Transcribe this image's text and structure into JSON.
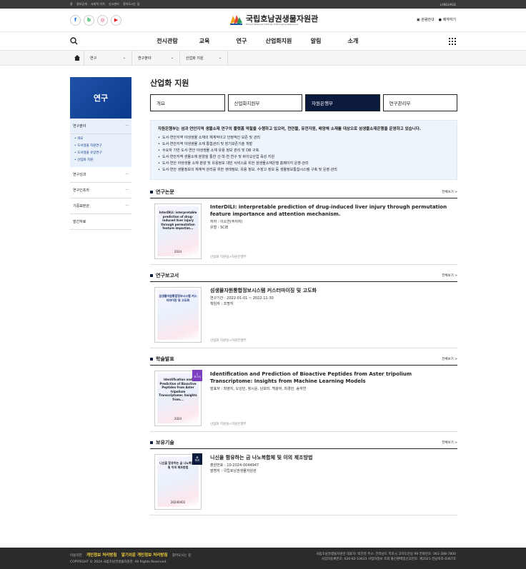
{
  "topbar": {
    "links": [
      "홈",
      "정보공개",
      "사회적 가치",
      "신고센터",
      "찾아오시는 길"
    ],
    "language": "LANGUAGE"
  },
  "header": {
    "sns": [
      "f",
      "b",
      "◎",
      "▶"
    ],
    "logo_name": "국립호남권생물자원관",
    "logo_sub": "Honam National Institute of Biological Resources",
    "right_links": [
      "관람안내",
      "예약하기"
    ]
  },
  "gnb": {
    "menu": [
      "전시관람",
      "교육",
      "연구",
      "산업화지원",
      "알림",
      "소개"
    ]
  },
  "breadcrumb": [
    "연구",
    "연구분야",
    "산업화 지원"
  ],
  "sidebar": {
    "title": "연구",
    "items": [
      {
        "label": "연구분야",
        "subs": [
          "개요",
          "도서생물 자원연구",
          "도서생물 유망연구",
          "산업화 지원"
        ]
      },
      {
        "label": "연구성과"
      },
      {
        "label": "연구인프라"
      },
      {
        "label": "기증표본관"
      },
      {
        "label": "발간자료"
      }
    ]
  },
  "main": {
    "title": "산업화 지원",
    "tabs": [
      "개요",
      "산업화지원부",
      "자원은행부",
      "연구관리부"
    ],
    "active_tab": 2,
    "intro_lead": "자원은행부는 섬과 연안지역 생물소재 연구의 플랫폼 역할을 수행하고 있으며, 천연물, 유전자원, 배양체 소재를 대상으로 섬생물소재은행을 운영하고 있습니다.",
    "intro_items": [
      "도서·연안지역 야생생물 소재의 체계적이고 안정적인 보존 및 관리",
      "도서·연안지역 야생생물 소재 통합관리 및 장기보존기술 개발",
      "수요자 기반 도서·연안 야생생물 소재 유용 정보 관리 및 DB 구축",
      "도서·연안지역 생물소재 분양을 통한 산·학·연 연구 및 바이오산업 육성 지원",
      "도서·연안 야생생물 소재 분양 및 유용정보 대민 서비스를 위한 섬생물소재은행 홈페이지 운영·관리",
      "도서·연안 생물정보의 체계적 관리를 위한 생태정보, 유용 정보, 수장고 정보 등 생물정보통합시스템 구축 및 운영·관리"
    ]
  },
  "sections": [
    {
      "title": "연구논문",
      "more": "전체보기 >",
      "thumb_text": "InterDILI: interpretable prediction of drug-induced liver injury through permutation feature importan...",
      "thumb_year": "2024",
      "badge": "",
      "heading": "InterDILI: interpretable prediction of drug-induced liver injury through permutation feature importance and attention mechanism.",
      "meta": [
        "저자 : 이소연(주저자)",
        "유형 : SCIE"
      ],
      "path": "산업화 지원실>자원은행부"
    },
    {
      "title": "연구보고서",
      "more": "전체보기 >",
      "thumb_text": "섬생물자원통합정보시스템 커스터마이징 및 고도화",
      "thumb_year": "",
      "badge": "",
      "heading": "섬생물자원통합정보시스템 커스터마이징 및 고도화",
      "meta": [
        "연구기간 : 2022-01-01 ~ 2022-11-30",
        "책임자 : 조명지"
      ],
      "path": "산업화 지원실>자원은행부"
    },
    {
      "title": "학술발표",
      "more": "전체보기 >",
      "thumb_text": "Identification and Prediction of Bioactive Peptides from Aster tripolium Transcriptome: Insights from...",
      "thumb_year": "2024",
      "badge": "포스터",
      "heading": "Identification and Prediction of Bioactive Peptides from Aster tripolium Transcriptome: Insights from Machine Learning Models",
      "meta": [
        "발표자 : 최영지, 오성민, 정시윤, 남보미, 백광여, 최경민, 송하연"
      ],
      "path": "산업화 지원실>자원은행부"
    },
    {
      "title": "보유기술",
      "more": "전체보기 >",
      "thumb_text": "니신을 함유하는 금 나노복합체 및 이의 제조방법",
      "thumb_year": "20240402",
      "badge": "특허",
      "heading": "니신을 함유하는 금 나노복합체 및 이의 제조방법",
      "meta": [
        "출원번호 : 10-2024-0044947",
        "발명자 : 국립호남권생물자원관"
      ],
      "path": ""
    }
  ],
  "footer": {
    "links": [
      "이용약관",
      "개인정보 처리방침",
      "알기쉬운 개인정보 처리방침",
      "찾아오시는 길"
    ],
    "copyright": "COPYRIGHT © 2024 국립호남권생물자원관. All Rights Reserved.",
    "addr1": "국립호남권생물자원관  대표자: 박진영  주소: 전라남도 목포시 고하도안길 99  전화번호: 061-288-7800",
    "addr2": "사업자등록번호: 620-82-10633  사업자정보 조회  통신판매업신고번호: 제2021-전남목포-0367호"
  }
}
